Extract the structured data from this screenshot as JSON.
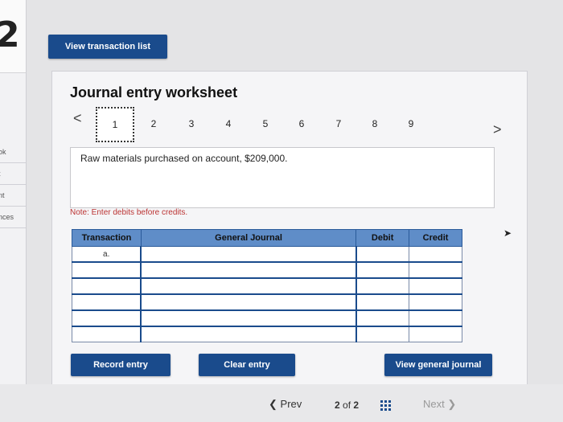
{
  "side": {
    "number": "2",
    "items": [
      "ok",
      "t",
      "nt",
      "nces"
    ]
  },
  "toolbar": {
    "view_list_label": "View transaction list"
  },
  "worksheet": {
    "title": "Journal entry worksheet",
    "prev_arrow": "<",
    "next_arrow": ">",
    "steps": [
      "1",
      "2",
      "3",
      "4",
      "5",
      "6",
      "7",
      "8",
      "9"
    ],
    "active_step": "1",
    "description": "Raw materials purchased on account, $209,000.",
    "note": "Note: Enter debits before credits."
  },
  "table": {
    "headers": {
      "transaction": "Transaction",
      "general_journal": "General Journal",
      "debit": "Debit",
      "credit": "Credit"
    },
    "first_row_label": "a."
  },
  "buttons": {
    "record": "Record entry",
    "clear": "Clear entry",
    "view_journal": "View general journal"
  },
  "pagination": {
    "prev": "Prev",
    "current": "2",
    "of": "of",
    "total": "2",
    "next": "Next"
  },
  "colors": {
    "primary": "#1a4b8c",
    "header": "#5f8dc8",
    "note": "#b33333"
  }
}
